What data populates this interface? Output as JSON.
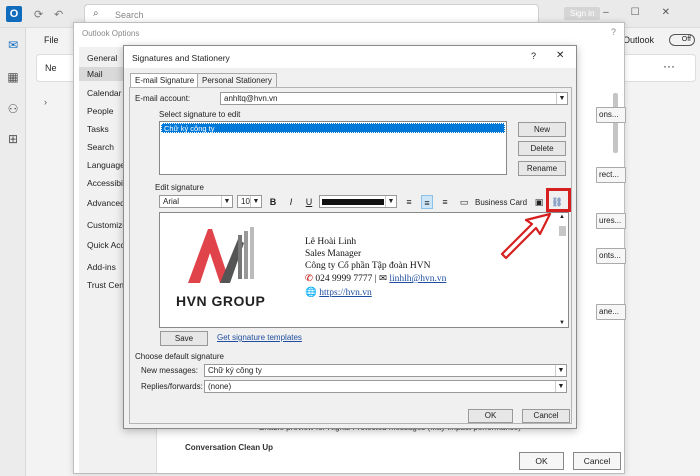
{
  "titlebar": {
    "search_placeholder": "Search",
    "signin_label": "Sign in"
  },
  "ribbon": {
    "file_label": "File",
    "new_label": "Ne",
    "outlook_label": "Outlook",
    "toggle_label": "Off",
    "more_label": "···"
  },
  "options": {
    "title": "Outlook Options",
    "close_label": "?",
    "nav": [
      "General",
      "Mail",
      "Calendar",
      "People",
      "Tasks",
      "Search",
      "Language",
      "Accessibili",
      "Advanced",
      "Customize",
      "Quick Acc",
      "Add-ins",
      "Trust Cente"
    ],
    "right_buttons": [
      "ons...",
      "rect...",
      "ures...",
      "onts...",
      "ane..."
    ],
    "bottom_text": "Enable preview for Rights Protected messages (May impact performance)",
    "bottom_heading": "Conversation Clean Up",
    "ok_label": "OK",
    "cancel_label": "Cancel"
  },
  "sig": {
    "title": "Signatures and Stationery",
    "help": "?",
    "close": "✕",
    "tabs": [
      "E-mail Signature",
      "Personal Stationery"
    ],
    "email_account_label": "E-mail account:",
    "email_account_value": "anhltq@hvn.vn",
    "select_label": "Select signature to edit",
    "signatures": [
      "Chữ ký công ty"
    ],
    "new_label": "New",
    "delete_label": "Delete",
    "rename_label": "Rename",
    "edit_label": "Edit signature",
    "font_value": "Arial",
    "size_value": "10",
    "bold": "B",
    "italic": "I",
    "underline": "U",
    "business_card_label": "Business Card",
    "save_label": "Save",
    "templates_link": "Get signature templates",
    "default_label": "Choose default signature",
    "new_messages_label": "New messages:",
    "new_messages_value": "Chữ ký công ty",
    "replies_label": "Replies/forwards:",
    "replies_value": "(none)",
    "ok_label": "OK",
    "cancel_label": "Cancel"
  },
  "signature_content": {
    "logo_text": "HVN GROUP",
    "name": "Lê Hoài Linh",
    "position": "Sales Manager",
    "company": "Công ty Cổ phần Tập đoàn HVN",
    "phone": "024 9999 7777",
    "separator": "|",
    "email": "linhlh@hvn.vn",
    "website": "https://hvn.vn"
  },
  "colors": {
    "accent": "#0078d7",
    "highlight": "#d62020",
    "logo_red": "#e0434a",
    "logo_gray": "#555555",
    "link": "#1f4e9e"
  }
}
